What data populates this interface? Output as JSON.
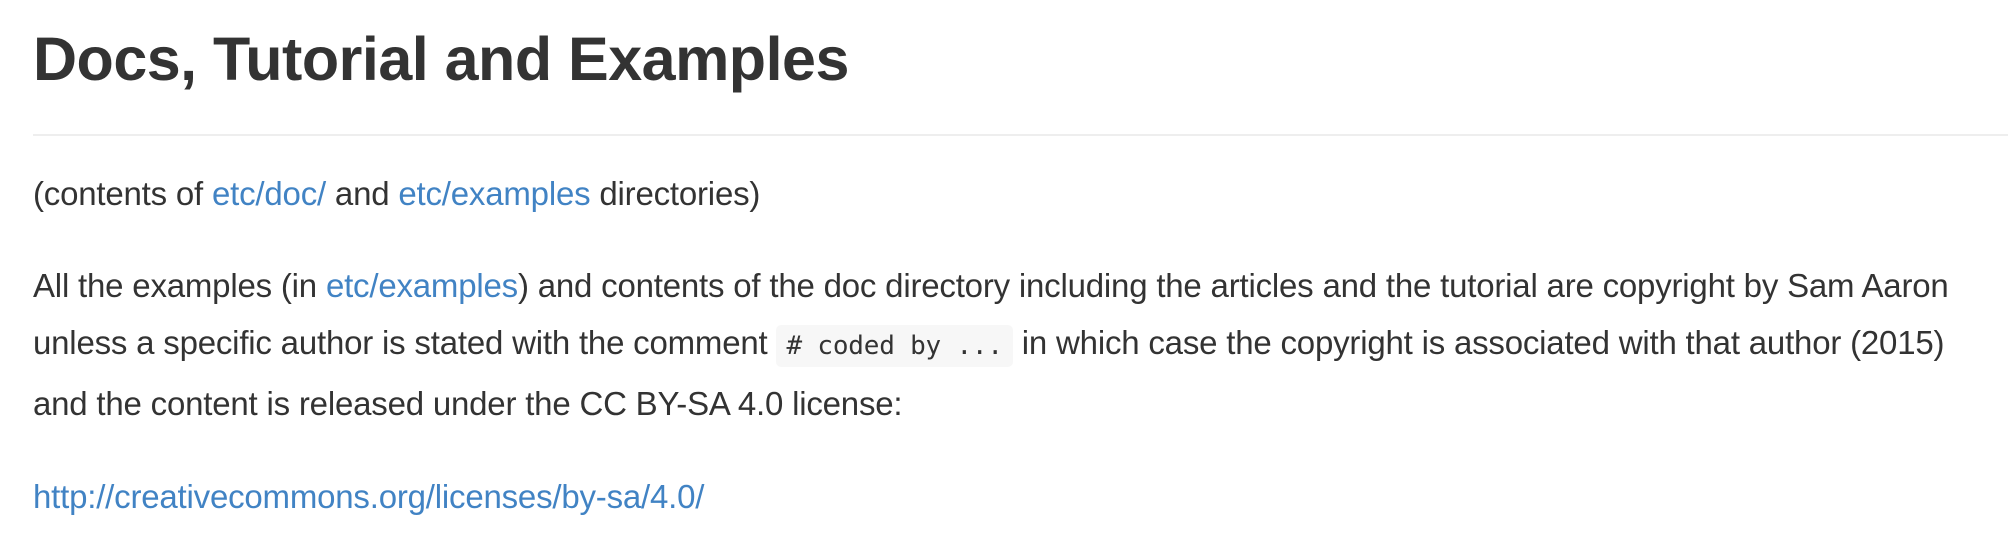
{
  "heading": "Docs, Tutorial and Examples",
  "dirs_paragraph": {
    "prefix": "(contents of ",
    "link1": "etc/doc/",
    "middle": " and ",
    "link2": "etc/examples",
    "suffix": " directories)"
  },
  "copyright_paragraph": {
    "prefix": "All the examples (in ",
    "link": "etc/examples",
    "text1": ") and contents of the doc directory including the articles and the tutorial are copyright by Sam Aaron unless a specific author is stated with the comment ",
    "code": "# coded by ...",
    "text2": " in which case the copyright is associated with that author (2015) and the content is released under the CC BY-SA 4.0 license:"
  },
  "license_link": "http://creativecommons.org/licenses/by-sa/4.0/",
  "colors": {
    "text": "#333333",
    "link": "#4183c4",
    "rule": "#eeeeee",
    "code_bg": "#f7f7f7"
  }
}
